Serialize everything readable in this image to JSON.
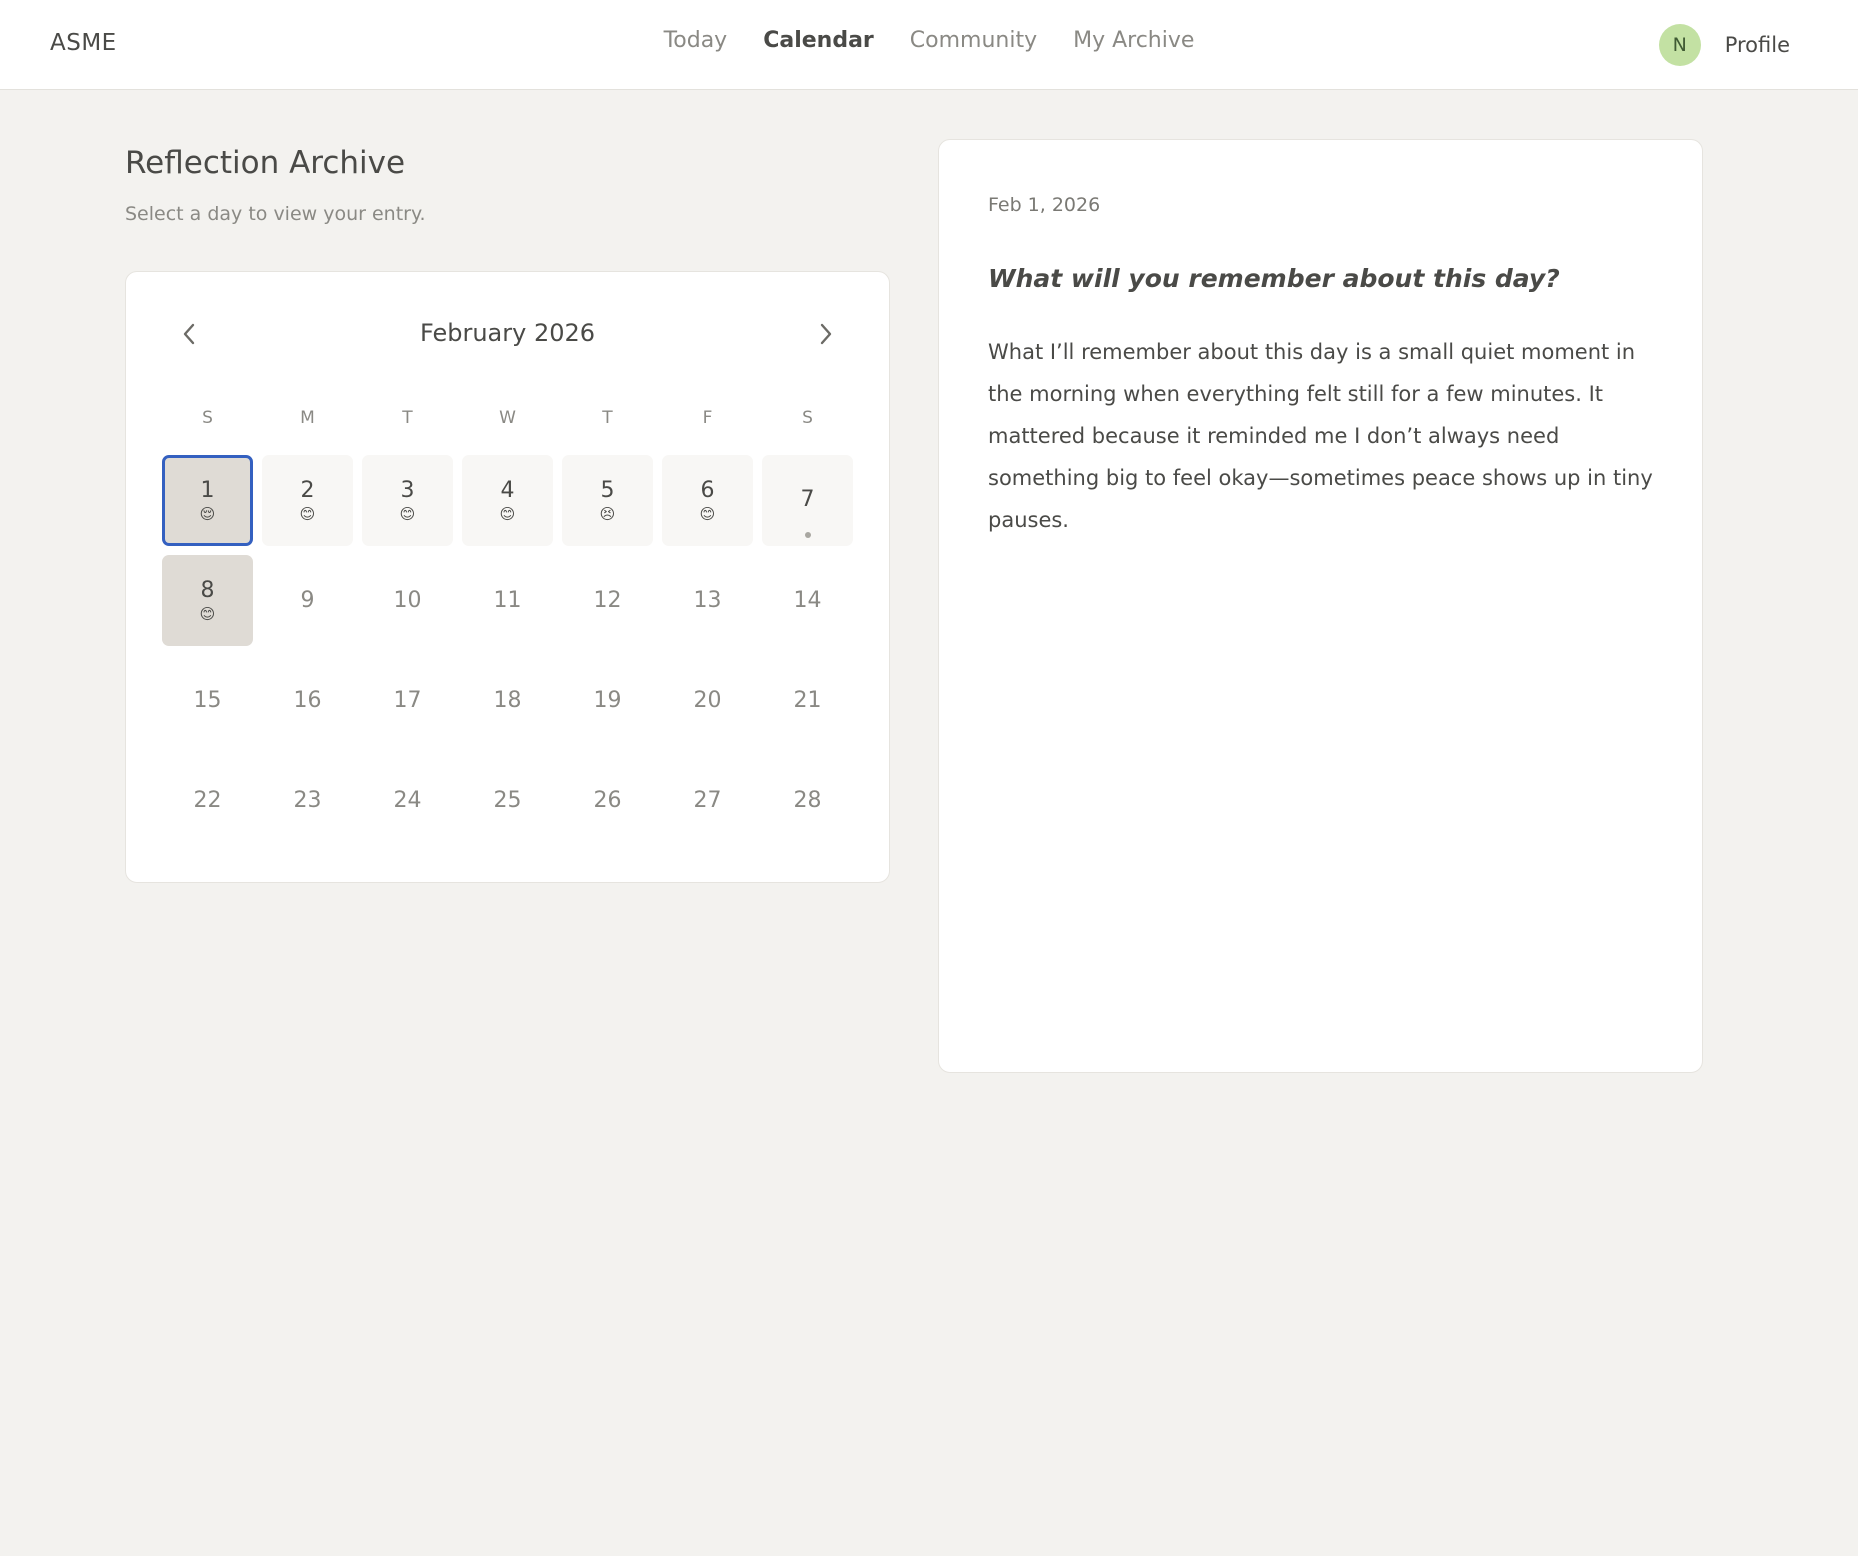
{
  "app": {
    "brand": "ASME"
  },
  "nav": {
    "items": [
      {
        "label": "Today",
        "active": false
      },
      {
        "label": "Calendar",
        "active": true
      },
      {
        "label": "Community",
        "active": false
      },
      {
        "label": "My Archive",
        "active": false
      }
    ]
  },
  "profile": {
    "avatar_initial": "N",
    "label": "Profile",
    "avatar_color": "#c3e1a3"
  },
  "page": {
    "title": "Reflection Archive",
    "subtitle": "Select a day to view your entry."
  },
  "calendar": {
    "month_label": "February 2026",
    "prev_icon": "chevron-left-icon",
    "next_icon": "chevron-right-icon",
    "weekdays": [
      "S",
      "M",
      "T",
      "W",
      "T",
      "F",
      "S"
    ],
    "selected_color": "#3460c0",
    "days": [
      {
        "num": "1",
        "emoji": "😌",
        "has_entry": true,
        "shaded": true,
        "selected": true
      },
      {
        "num": "2",
        "emoji": "😊",
        "has_entry": true
      },
      {
        "num": "3",
        "emoji": "😊",
        "has_entry": true
      },
      {
        "num": "4",
        "emoji": "😊",
        "has_entry": true
      },
      {
        "num": "5",
        "emoji": "😣",
        "has_entry": true
      },
      {
        "num": "6",
        "emoji": "😊",
        "has_entry": true
      },
      {
        "num": "7",
        "has_entry": true,
        "dot": true
      },
      {
        "num": "8",
        "emoji": "😊",
        "has_entry": true,
        "shaded": true
      },
      {
        "num": "9"
      },
      {
        "num": "10"
      },
      {
        "num": "11"
      },
      {
        "num": "12"
      },
      {
        "num": "13"
      },
      {
        "num": "14"
      },
      {
        "num": "15"
      },
      {
        "num": "16"
      },
      {
        "num": "17"
      },
      {
        "num": "18"
      },
      {
        "num": "19"
      },
      {
        "num": "20"
      },
      {
        "num": "21"
      },
      {
        "num": "22"
      },
      {
        "num": "23"
      },
      {
        "num": "24"
      },
      {
        "num": "25"
      },
      {
        "num": "26"
      },
      {
        "num": "27"
      },
      {
        "num": "28"
      }
    ]
  },
  "entry": {
    "date": "Feb 1, 2026",
    "question": "What will you remember about this day?",
    "body": "What I’ll remember about this day is a small quiet moment in the morning when everything felt still for a few minutes. It mattered because it reminded me I don’t always need something big to feel okay—sometimes peace shows up in tiny pauses."
  }
}
